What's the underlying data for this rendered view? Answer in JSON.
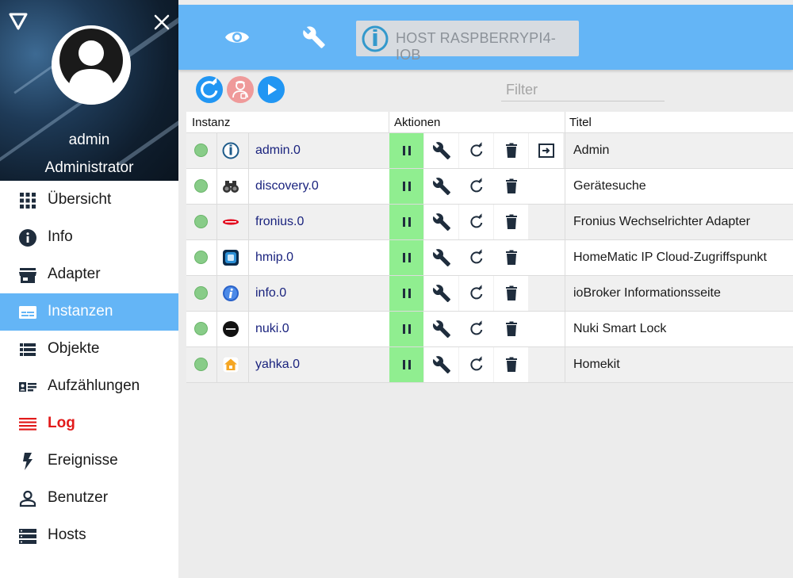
{
  "sidebar": {
    "user_name": "admin",
    "user_role": "Administrator",
    "items": [
      {
        "label": "Übersicht",
        "icon": "apps-grid-icon",
        "active": false
      },
      {
        "label": "Info",
        "icon": "info-icon",
        "active": false
      },
      {
        "label": "Adapter",
        "icon": "store-icon",
        "active": false
      },
      {
        "label": "Instanzen",
        "icon": "instances-icon",
        "active": true
      },
      {
        "label": "Objekte",
        "icon": "list-icon",
        "active": false
      },
      {
        "label": "Aufzählungen",
        "icon": "enum-card-icon",
        "active": false
      },
      {
        "label": "Log",
        "icon": "log-lines-icon",
        "active": false
      },
      {
        "label": "Ereignisse",
        "icon": "flash-icon",
        "active": false
      },
      {
        "label": "Benutzer",
        "icon": "person-icon",
        "active": false
      },
      {
        "label": "Hosts",
        "icon": "server-icon",
        "active": false
      }
    ]
  },
  "topbar": {
    "host_label": "HOST RASPBERRYPI4-IOB"
  },
  "toolbar": {
    "filter_placeholder": "Filter"
  },
  "table": {
    "headers": {
      "instance": "Instanz",
      "actions": "Aktionen",
      "title": "Titel"
    },
    "rows": [
      {
        "name": "admin.0",
        "title": "Admin",
        "icon": "iobroker-logo-icon",
        "has_open": true
      },
      {
        "name": "discovery.0",
        "title": "Gerätesuche",
        "icon": "binoculars-icon",
        "has_open": false
      },
      {
        "name": "fronius.0",
        "title": "Fronius Wechselrichter Adapter",
        "icon": "fronius-logo-icon",
        "has_open": false
      },
      {
        "name": "hmip.0",
        "title": "HomeMatic IP Cloud-Zugriffspunkt",
        "icon": "hmip-logo-icon",
        "has_open": false
      },
      {
        "name": "info.0",
        "title": "ioBroker Informationsseite",
        "icon": "info-adapter-icon",
        "has_open": false
      },
      {
        "name": "nuki.0",
        "title": "Nuki Smart Lock",
        "icon": "nuki-logo-icon",
        "has_open": false
      },
      {
        "name": "yahka.0",
        "title": "Homekit",
        "icon": "homekit-house-icon",
        "has_open": false
      }
    ]
  },
  "colors": {
    "accent": "#64b5f6",
    "fab_blue": "#2196f3",
    "fab_expert": "#ef9a9a",
    "running_green": "#90ee90",
    "status_dot": "#88cc88",
    "log_red": "#e21b1b",
    "instance_link": "#1a237e"
  }
}
